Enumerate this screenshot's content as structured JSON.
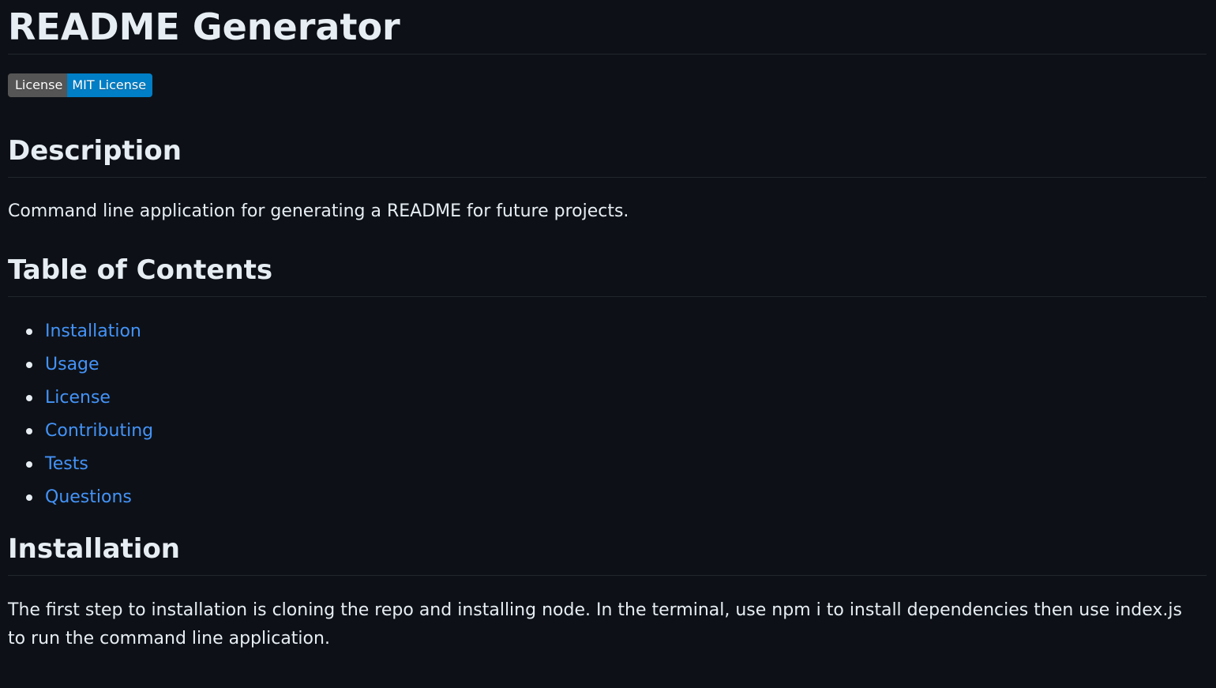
{
  "title": "README Generator",
  "badge": {
    "label": "License",
    "value": "MIT License",
    "label_color": "#555555",
    "value_color": "#007ec6"
  },
  "sections": {
    "description": {
      "heading": "Description",
      "text": "Command line application for generating a README for future projects."
    },
    "toc": {
      "heading": "Table of Contents",
      "items": [
        {
          "label": "Installation"
        },
        {
          "label": "Usage"
        },
        {
          "label": "License"
        },
        {
          "label": "Contributing"
        },
        {
          "label": "Tests"
        },
        {
          "label": "Questions"
        }
      ]
    },
    "installation": {
      "heading": "Installation",
      "text": "The first step to installation is cloning the repo and installing node. In the terminal, use npm i to install dependencies then use index.js to run the command line application."
    }
  },
  "colors": {
    "background": "#0d1117",
    "text": "#e6edf3",
    "link": "#4493f8",
    "divider": "#21262d"
  }
}
